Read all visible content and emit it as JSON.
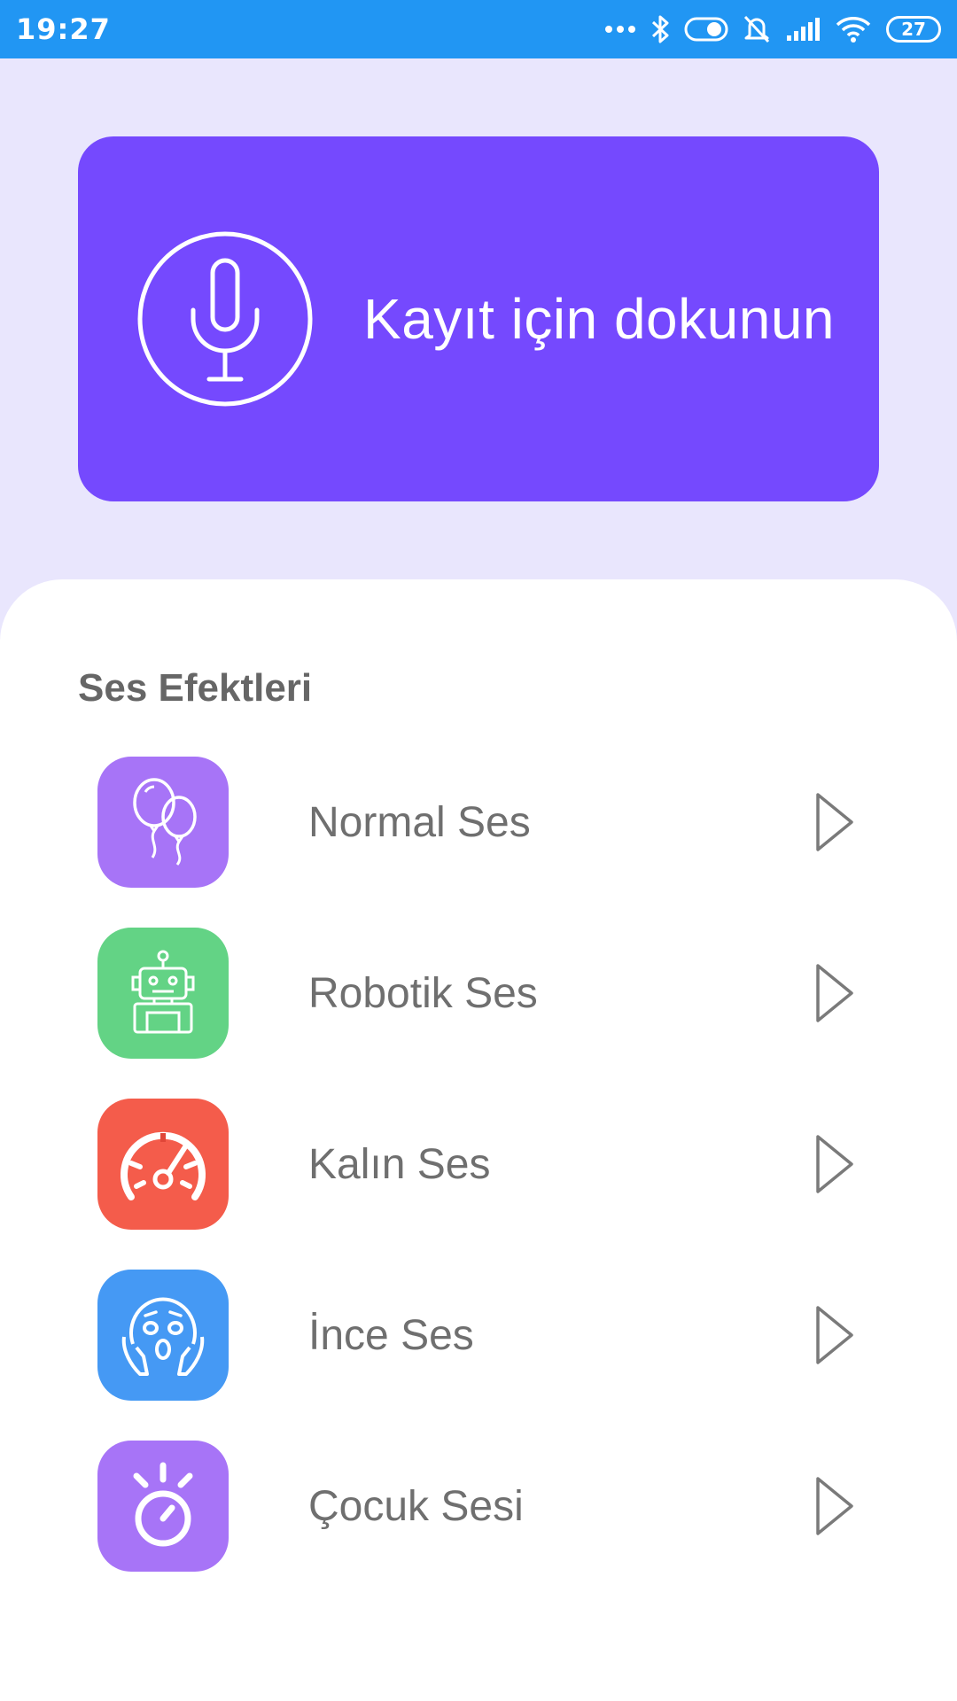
{
  "status_bar": {
    "time": "19:27",
    "battery": "27",
    "icons": [
      "more-dots-icon",
      "bluetooth-icon",
      "toggle-icon",
      "mute-bell-icon",
      "signal-icon",
      "wifi-icon",
      "battery-icon"
    ]
  },
  "record": {
    "label": "Kayıt için dokunun",
    "icon": "microphone-icon",
    "color": "#7549fe"
  },
  "effects": {
    "title": "Ses Efektleri",
    "items": [
      {
        "label": "Normal Ses",
        "icon": "balloons-icon",
        "color": "#a774f7"
      },
      {
        "label": "Robotik Ses",
        "icon": "robot-icon",
        "color": "#63d385"
      },
      {
        "label": "Kalın Ses",
        "icon": "speedometer-icon",
        "color": "#f45c4b"
      },
      {
        "label": "İnce Ses",
        "icon": "scared-face-icon",
        "color": "#4599f4"
      },
      {
        "label": "Çocuk Sesi",
        "icon": "stopwatch-icon",
        "color": "#a774f7"
      }
    ],
    "play_icon": "play-icon"
  },
  "colors": {
    "status_bar": "#2196f3",
    "background": "#e9e6fd",
    "sheet": "#ffffff"
  }
}
